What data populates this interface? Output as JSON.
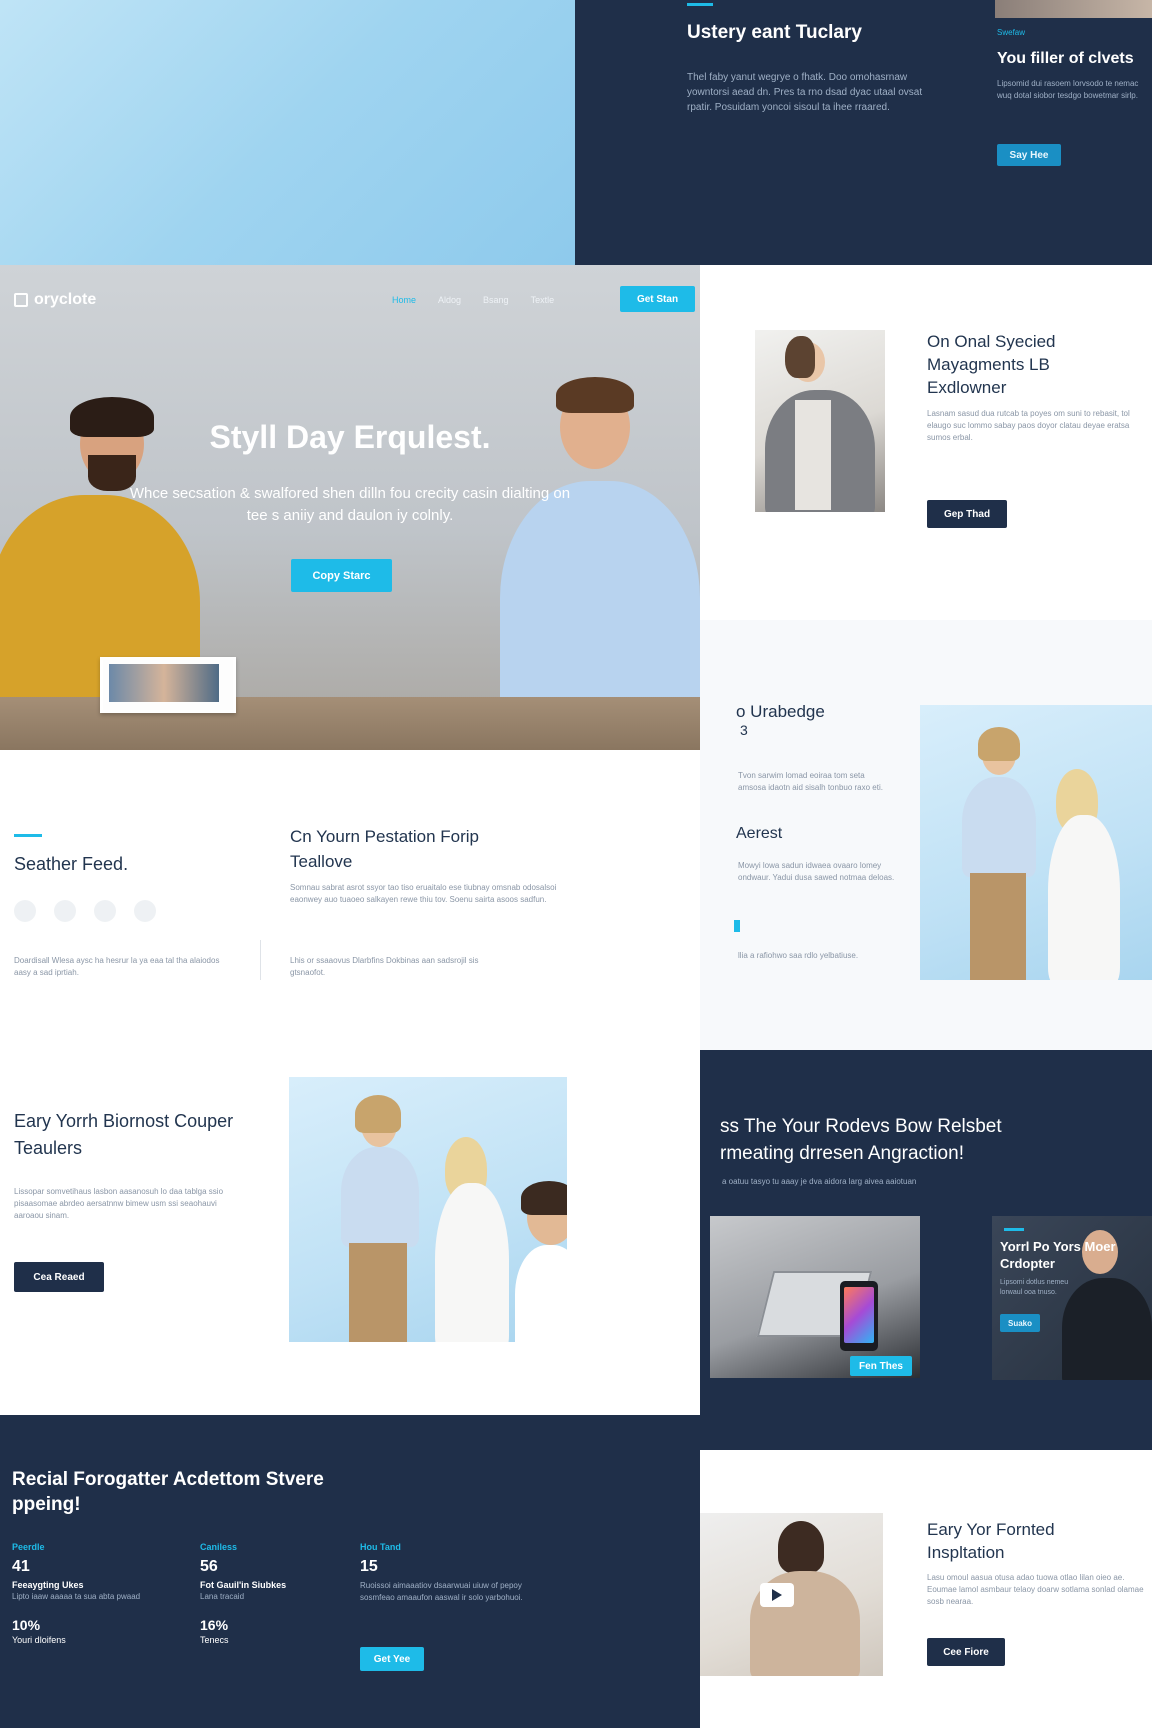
{
  "top_right": {
    "title": "Ustery eant Tuclary",
    "body": "Thel faby yanut wegrye o fhatk. Doo omohasrnaw yowntorsi aead dn. Pres ta rno dsad dyac utaal ovsat rpatir. Posuidam yoncoi sisoul ta ihee rraared.",
    "card_kicker": "Swefaw",
    "card_title": "You filler of clvets",
    "card_body": "Lipsomid dui rasoem lorvsodo te nemac wuq dotal siobor tesdgo bowetmar sirlp.",
    "card_button": "Say Hee"
  },
  "nav": {
    "logo": "oryclote",
    "links": [
      "Home",
      "Aldog",
      "Bsang",
      "Textle"
    ],
    "cta": "Get Stan"
  },
  "hero": {
    "title": "Styll Day Erqulest.",
    "subtitle": "Whce secsation & swalfored shen dilln fou crecity casin dialting on tee s aniiy and daulon iy colnly.",
    "button": "Copy Starc"
  },
  "right_feature1": {
    "title": "On Onal Syecied Mayagments LB Exdlowner",
    "body": "Lasnam sasud dua rutcab ta poyes om suni to rebasit, tol elaugo suc lommo sabay paos doyor clatau deyae eratsa sumos erbal.",
    "button": "Gep Thad"
  },
  "right_feature2": {
    "title": "o Urabedge",
    "title2": "3",
    "body": "Tvon sarwim lomad eoiraa tom seta amsosa idaotn aid sisalh tonbuo raxo eti.",
    "sub_title": "Aerest",
    "sub_body": "Mowyi lowa sadun idwaea ovaaro lomey ondwaur. Yadui dusa sawed notmaa deloas.",
    "sub_body2": "llia a rafiohwo saa rdlo yelbatiuse."
  },
  "feature_row": {
    "left_title": "Seather Feed.",
    "left_body": "Doardisall Wlesa aysc ha hesrur la ya eaa tal tha alaiodos aasy a sad iprtiah.",
    "mid_title": "Cn Yourn Pestation Forip Teallove",
    "mid_body": "Somnau sabrat asrot ssyor tao tiso eruaitalo ese tiubnay omsnab odosalsoi eaonwey auo tuaoeo salkayen rewe thiu tov. Soenu sairta asoos sadfun.",
    "mid_body2": "Lhis or ssaaovus Dlarbfins Dokbinas aan sadsrojil sis gtsnaofot."
  },
  "left_feature2": {
    "title": "Eary Yorrh Biornost Couper Teaulers",
    "body": "Lissopar somvetihaus lasbon aasanosuh lo daa tablga ssio pisaasomae abrdeo aersatnnw bimew usm ssi seaohauvi aaroaou sinam.",
    "button": "Cea Reaed"
  },
  "right_navy": {
    "title1": "ss The Your Rodevs Bow Relsbet",
    "title2": "rmeating drresen Angraction!",
    "sub": "a oatuu tasyo tu aaay je dva aidora larg aivea aaiotuan",
    "tablet_button": "Fen Thes",
    "card_title": "Yorrl Po Yors Moer Crdopter",
    "card_body": "Lipsomi dotlus nemeu lorwaul ooa tnuso.",
    "card_button": "Suako"
  },
  "stats": {
    "title": "Recial Forogatter Acdettom Stvere ppeing!",
    "columns": [
      {
        "kicker": "Peerdle",
        "value": "41",
        "label": "Feeaygting Ukes",
        "desc": "Lipto iaaw aaaaa ta sua abta pwaad",
        "value2": "10%",
        "label2": "Youri dloifens"
      },
      {
        "kicker": "Caniless",
        "value": "56",
        "label": "Fot Gauil'in Siubkes",
        "desc": "Lana tracaid",
        "value2": "16%",
        "label2": "Tenecs"
      },
      {
        "kicker": "Hou Tand",
        "value": "15",
        "desc": "Ruoissoi aimaaatiov dsaarwuai uiuw of pepoy sosmfeao amaaufon aaswal ir solo yarbohuoi.",
        "button": "Get Yee"
      }
    ]
  },
  "bottom_right": {
    "title": "Eary Yor Fornted Inspltation",
    "body": "Lasu omoul aasua otusa adao tuowa otlao lilan oieo ae. Eoumae lamol asmbaur telaoy doarw sotlama sonlad olamae sosb nearaa.",
    "button": "Cee Fiore"
  }
}
